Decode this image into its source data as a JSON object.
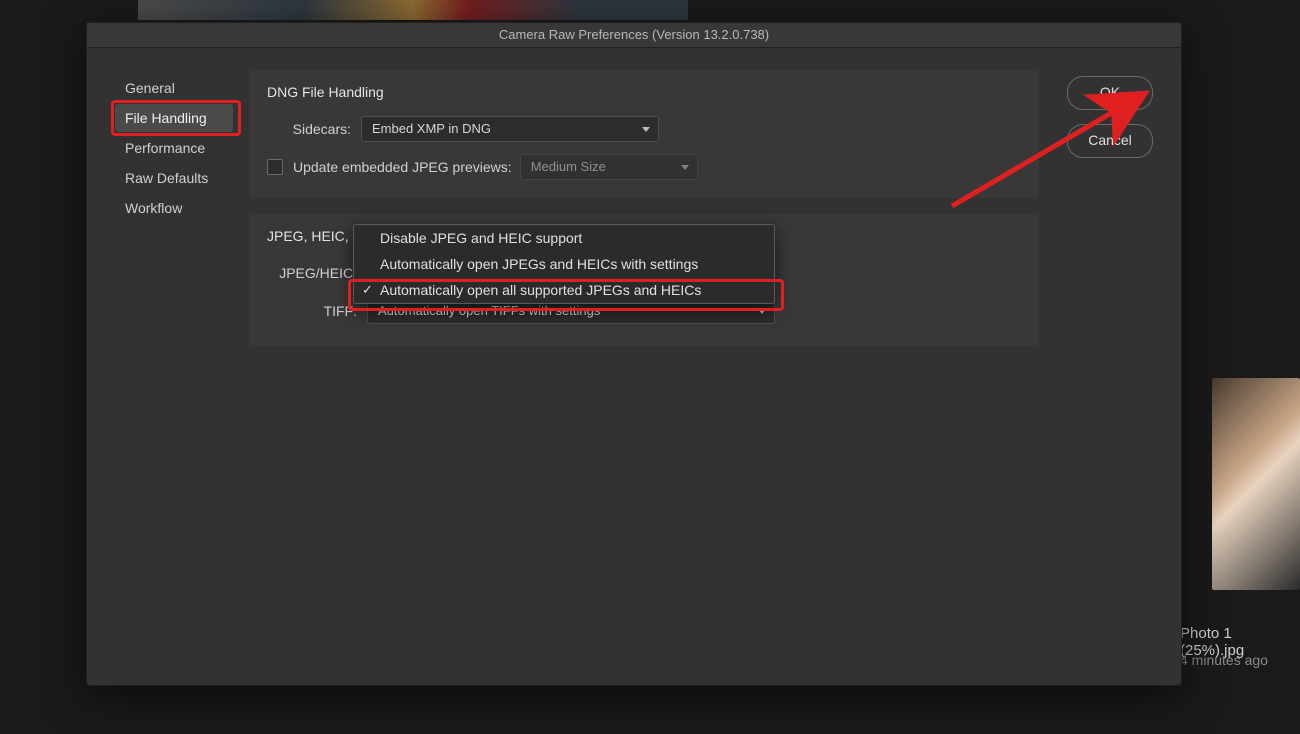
{
  "window": {
    "title": "Camera Raw Preferences  (Version 13.2.0.738)"
  },
  "sidebar": {
    "items": [
      {
        "label": "General"
      },
      {
        "label": "File Handling"
      },
      {
        "label": "Performance"
      },
      {
        "label": "Raw Defaults"
      },
      {
        "label": "Workflow"
      }
    ]
  },
  "buttons": {
    "ok": "OK",
    "cancel": "Cancel"
  },
  "panels": {
    "dng": {
      "title": "DNG File Handling",
      "sidecars_label": "Sidecars:",
      "sidecars_value": "Embed XMP in DNG",
      "update_label": "Update embedded JPEG previews:",
      "update_value": "Medium Size"
    },
    "jpeg": {
      "title": "JPEG, HEIC,",
      "jpeg_label": "JPEG/HEIC:",
      "tiff_label": "TIFF:",
      "tiff_value": "Automatically open TIFFs with settings"
    }
  },
  "dropdown": {
    "items": [
      {
        "label": "Disable JPEG and HEIC support"
      },
      {
        "label": "Automatically open JPEGs and HEICs with settings"
      },
      {
        "label": "Automatically open all supported JPEGs and HEICs"
      }
    ]
  },
  "background": {
    "file_label": "Photo 1 (25%).jpg",
    "file_sub": "4 minutes ago"
  }
}
